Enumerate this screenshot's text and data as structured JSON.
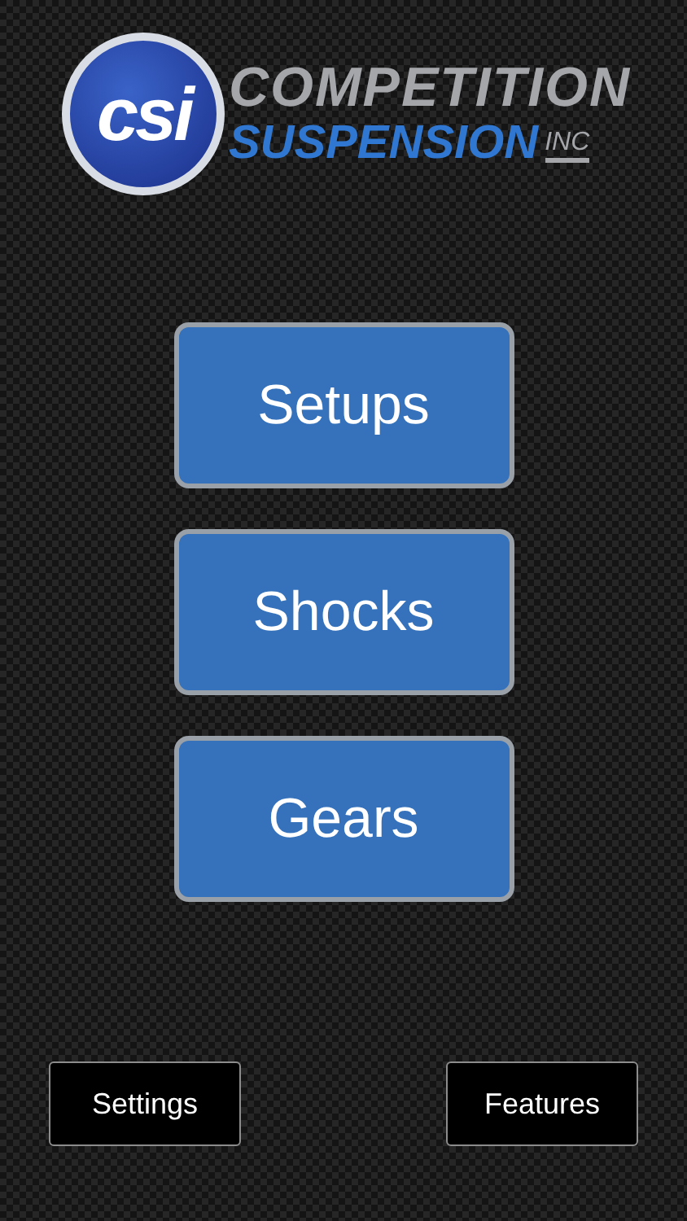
{
  "logo": {
    "badge": "csi",
    "line_1": "COMPETITION",
    "line_2": "SUSPENSION",
    "suffix": "INC"
  },
  "menu": [
    {
      "label": "Setups"
    },
    {
      "label": "Shocks"
    },
    {
      "label": "Gears"
    }
  ],
  "footer": {
    "left": "Settings",
    "right": "Features"
  }
}
